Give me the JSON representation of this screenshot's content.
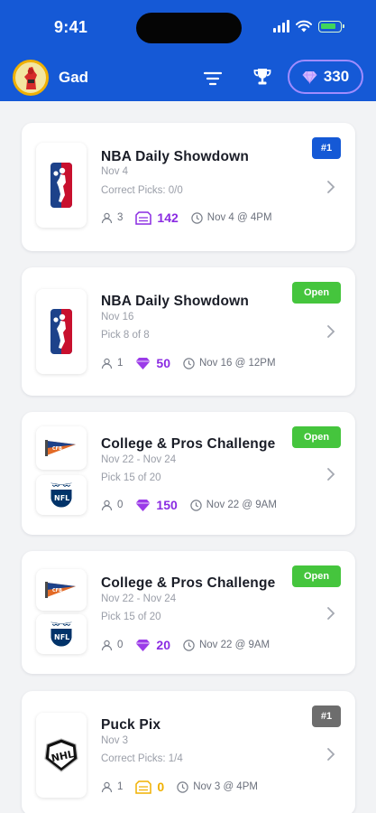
{
  "status_bar": {
    "time": "9:41"
  },
  "header": {
    "username": "Gad",
    "gems": "330"
  },
  "colors": {
    "header": "#1559d6",
    "accent_purple": "#8a2be2",
    "open_green": "#45c53d",
    "rank_blue": "#1559d6",
    "rank_gray": "#6d6d6d",
    "gold": "#f0b000"
  },
  "contests": [
    {
      "title": "NBA Daily Showdown",
      "date": "Nov 4",
      "progress": "Correct Picks: 0/0",
      "players": "3",
      "prize": "142",
      "prize_icon": "ticket-icon",
      "start": "Nov 4 @ 4PM",
      "badge": "#1",
      "badge_type": "rank",
      "leagues": [
        "nba-logo-icon"
      ]
    },
    {
      "title": "NBA Daily Showdown",
      "date": "Nov 16",
      "progress": "Pick 8 of 8",
      "players": "1",
      "prize": "50",
      "prize_icon": "gem-icon",
      "start": "Nov 16 @ 12PM",
      "badge": "Open",
      "badge_type": "open",
      "leagues": [
        "nba-logo-icon"
      ]
    },
    {
      "title": "College & Pros Challenge",
      "date": "Nov 22 - Nov 24",
      "progress": "Pick 15 of 20",
      "players": "0",
      "prize": "150",
      "prize_icon": "gem-icon",
      "start": "Nov 22 @ 9AM",
      "badge": "Open",
      "badge_type": "open",
      "leagues": [
        "college-pennant-icon",
        "nfl-logo-icon"
      ]
    },
    {
      "title": "College & Pros Challenge",
      "date": "Nov 22 - Nov 24",
      "progress": "Pick 15 of 20",
      "players": "0",
      "prize": "20",
      "prize_icon": "gem-icon",
      "start": "Nov 22 @ 9AM",
      "badge": "Open",
      "badge_type": "open",
      "leagues": [
        "college-pennant-icon",
        "nfl-logo-icon"
      ]
    },
    {
      "title": "Puck Pix",
      "date": "Nov 3",
      "progress": "Correct Picks: 1/4",
      "players": "1",
      "prize": "0",
      "prize_icon": "ticket-gold-icon",
      "start": "Nov 3 @ 4PM",
      "badge": "#1",
      "badge_type": "rank-gray",
      "leagues": [
        "nhl-logo-icon"
      ]
    }
  ]
}
